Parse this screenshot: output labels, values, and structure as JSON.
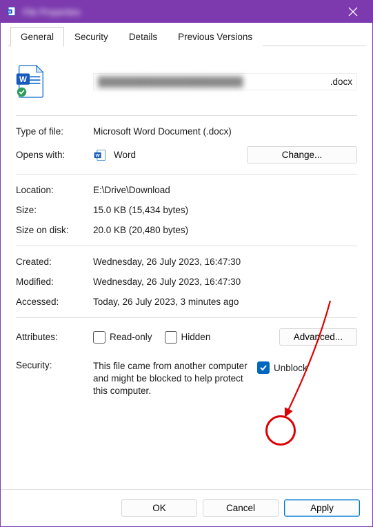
{
  "title": "File Properties",
  "tabs": {
    "general": "General",
    "security": "Security",
    "details": "Details",
    "previous": "Previous Versions"
  },
  "filename_hidden": "██████████████████████",
  "filename_ext": ".docx",
  "labels": {
    "type_of_file": "Type of file:",
    "opens_with": "Opens with:",
    "location": "Location:",
    "size": "Size:",
    "size_on_disk": "Size on disk:",
    "created": "Created:",
    "modified": "Modified:",
    "accessed": "Accessed:",
    "attributes": "Attributes:",
    "security": "Security:"
  },
  "values": {
    "type_of_file": "Microsoft Word Document (.docx)",
    "opens_with": "Word",
    "location": "E:\\Drive\\Download",
    "size": "15.0 KB (15,434 bytes)",
    "size_on_disk": "20.0 KB (20,480 bytes)",
    "created": "Wednesday, 26 July 2023, 16:47:30",
    "modified": "Wednesday, 26 July 2023, 16:47:30",
    "accessed": "Today, 26 July 2023, 3 minutes ago"
  },
  "attributes": {
    "read_only": "Read-only",
    "hidden": "Hidden",
    "advanced": "Advanced..."
  },
  "security": {
    "text": "This file came from another computer and might be blocked to help protect this computer.",
    "unblock": "Unblock"
  },
  "buttons": {
    "change": "Change...",
    "ok": "OK",
    "cancel": "Cancel",
    "apply": "Apply"
  }
}
